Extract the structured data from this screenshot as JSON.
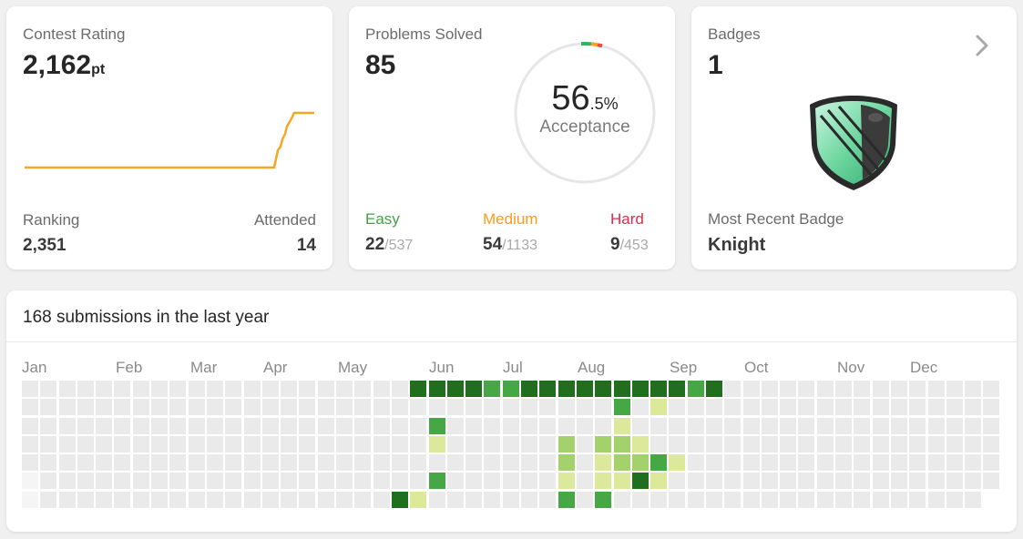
{
  "contest": {
    "title": "Contest Rating",
    "rating": "2,162",
    "rating_unit": "pt",
    "ranking_label": "Ranking",
    "ranking": "2,351",
    "attended_label": "Attended",
    "attended": "14",
    "line_color": "#f5a623"
  },
  "problems": {
    "title": "Problems Solved",
    "solved": "85",
    "acceptance_whole": "56",
    "acceptance_frac": ".5%",
    "acceptance_label": "Acceptance",
    "easy_label": "Easy",
    "easy_solved": "22",
    "easy_total": "/537",
    "medium_label": "Medium",
    "medium_solved": "54",
    "medium_total": "/1133",
    "hard_label": "Hard",
    "hard_solved": "9",
    "hard_total": "/453",
    "colors": {
      "easy": "#2db55d",
      "medium": "#ffa116",
      "hard": "#ef4743"
    }
  },
  "badges": {
    "title": "Badges",
    "count": "1",
    "recent_label": "Most Recent Badge",
    "recent_name": "Knight",
    "chevron_icon": "chevron-right-icon",
    "badge_icon": "knight-badge-icon"
  },
  "activity": {
    "title": "168 submissions in the last year",
    "months": [
      "Jan",
      "Feb",
      "Mar",
      "Apr",
      "May",
      "Jun",
      "Jul",
      "Aug",
      "Sep",
      "Oct",
      "Nov",
      "Dec"
    ],
    "colors": {
      "empty": "#eaeaea",
      "level1": "#dce89a",
      "level2": "#a3d26d",
      "level3": "#45a845",
      "level4": "#1f6f1f"
    }
  }
}
